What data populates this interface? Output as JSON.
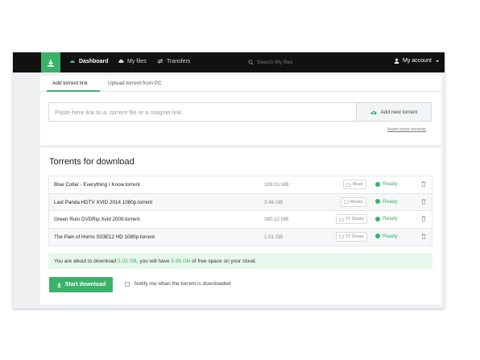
{
  "colors": {
    "accent": "#3bb269",
    "topbar": "#111111",
    "background": "#eef0f1"
  },
  "topbar": {
    "logo_icon": "download-arrow-icon",
    "nav": [
      {
        "label": "Dashboard",
        "icon": "gauge-icon",
        "active": true
      },
      {
        "label": "My files",
        "icon": "cloud-icon",
        "active": false
      },
      {
        "label": "Transfers",
        "icon": "transfer-arrows-icon",
        "active": false
      }
    ],
    "search_placeholder": "Search My files",
    "account_label": "My account"
  },
  "add_panel": {
    "tabs": [
      {
        "label": "Add torrent link",
        "active": true
      },
      {
        "label": "Upload torrent from PC",
        "active": false
      }
    ],
    "input_placeholder": "Paste here link to a .torrent file or a magnet link.",
    "add_button": "Add new torrent",
    "insert_more": "Insert more torrents"
  },
  "torrents": {
    "title": "Torrents for download",
    "rows": [
      {
        "name": "Blue Collar - Everything I Know.torrent",
        "size": "189.01 MB",
        "category": "Music",
        "status": "Ready"
      },
      {
        "name": "Last Panda HDTV XVID 2014 1080p.torrent",
        "size": "3.46 GB",
        "category": "Movies",
        "status": "Ready"
      },
      {
        "name": "Green Ruin DVDRip Xvid 2009.torrent",
        "size": "380.22 MB",
        "category": "TV Shows",
        "status": "Ready"
      },
      {
        "name": "The Pain of Horns S03E12 HD 1080p.torrent",
        "size": "1.01 GB",
        "category": "TV Shows",
        "status": "Ready"
      }
    ],
    "notice": {
      "prefix": "You are about to download ",
      "download_size": "5.03 GB",
      "middle": ", you will have ",
      "free_space": "5.95 GB",
      "suffix": " of free space on your cloud."
    },
    "start_button": "Start download",
    "notify_label": "Notify me when the torrent is downloaded"
  }
}
